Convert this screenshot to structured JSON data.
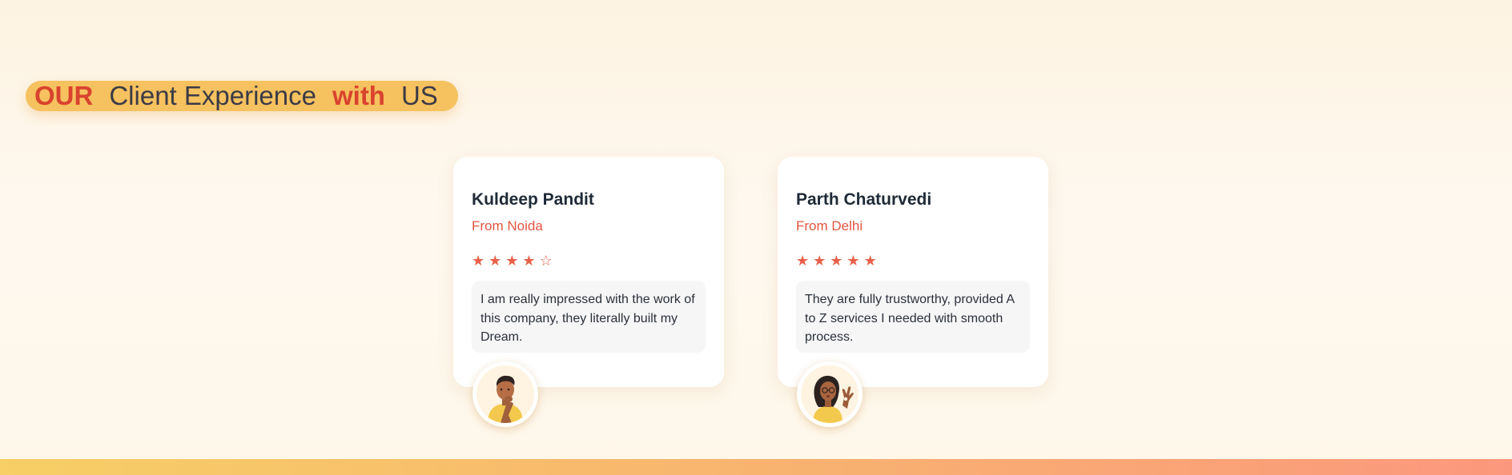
{
  "heading": {
    "parts": [
      "OUR",
      "Client Experience",
      "with",
      "US"
    ]
  },
  "testimonials": [
    {
      "name": "Kuldeep Pandit",
      "location": "From Noida",
      "rating": 4,
      "max_rating": 5,
      "stars": [
        "★",
        "★",
        "★",
        "★",
        "☆"
      ],
      "quote": "I am really impressed with the work of this company, they literally built my Dream.",
      "avatar": "man-thinking-avatar"
    },
    {
      "name": "Parth Chaturvedi",
      "location": "From Delhi",
      "rating": 5,
      "max_rating": 5,
      "stars": [
        "★",
        "★",
        "★",
        "★",
        "★"
      ],
      "quote": "They are fully trustworthy, provided A to Z services I needed with smooth process.",
      "avatar": "woman-ok-gesture-avatar"
    }
  ],
  "colors": {
    "accent": "#d9432e",
    "pill": "#f6c15f",
    "star": "#e8604a",
    "location": "#e2553f"
  }
}
